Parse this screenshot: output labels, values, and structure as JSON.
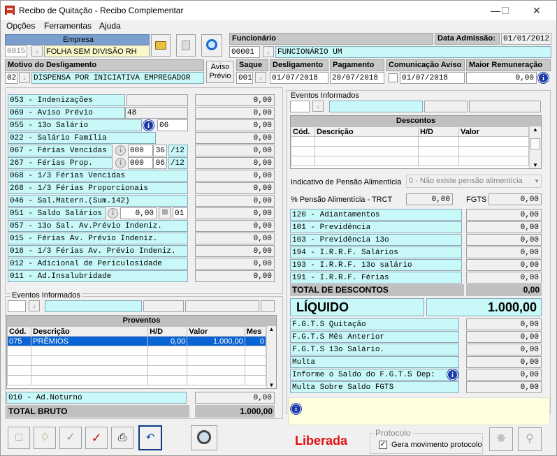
{
  "title": "Recibo de Quitação - Recibo Complementar",
  "menu": [
    "Opções",
    "Ferramentas",
    "Ajuda"
  ],
  "empresa": {
    "label": "Empresa",
    "code": "0015",
    "name": "FOLHA SEM DIVISÃO RH"
  },
  "funcionario": {
    "label": "Funcionário",
    "code": "00001",
    "name": "FUNCIONÁRIO UM"
  },
  "admissao": {
    "label": "Data Admissão:",
    "value": "01/01/2012"
  },
  "motivo": {
    "label": "Motivo do Desligamento",
    "code": "02",
    "name": "DISPENSA POR INICIATIVA EMPREGADOR"
  },
  "aviso_btn": "Aviso\nPrévio",
  "saque": {
    "label": "Saque",
    "value": "001"
  },
  "desligamento": {
    "label": "Desligamento",
    "value": "01/07/2018"
  },
  "pagamento": {
    "label": "Pagamento",
    "value": "20/07/2018"
  },
  "comunicacao": {
    "label": "Comunicação Aviso",
    "value": "01/07/2018"
  },
  "maior": {
    "label": "Maior Remuneração",
    "value": "0,00"
  },
  "left_rows": [
    {
      "label": "053 - Indenizações",
      "value": "0,00"
    },
    {
      "label": "069 - Aviso Prévio",
      "extra": "48",
      "value": "0,00"
    },
    {
      "label": "055 - 13o Salário",
      "extra": "06",
      "value": "0,00"
    },
    {
      "label": "022 - Salário Família",
      "value": "0,00"
    },
    {
      "label": "067 - Férias Vencidas",
      "a": "000",
      "b": "36",
      "c": "/12",
      "value": "0,00"
    },
    {
      "label": "267 - Férias Prop.",
      "a": "000",
      "b": "06",
      "c": "/12",
      "value": "0,00"
    },
    {
      "label": "068 - 1/3 Férias Vencidas",
      "value": "0,00"
    },
    {
      "label": "268 - 1/3 Férias Proporcionais",
      "value": "0,00"
    },
    {
      "label": "046 - Sal.Matern.(Sum.142)",
      "value": "0,00"
    },
    {
      "label": "051 - Saldo Salários",
      "a": "0,00",
      "b": "01",
      "value": "0,00"
    },
    {
      "label": "057 - 13o Sal. Av.Prévio Indeniz.",
      "value": "0,00"
    },
    {
      "label": "015 - Férias Av. Prévio Indeniz.",
      "value": "0,00"
    },
    {
      "label": "016 - 1/3 Férias Av. Prévio Indeniz.",
      "value": "0,00"
    },
    {
      "label": "012 - Adicional de Periculosidade",
      "value": "0,00"
    },
    {
      "label": "011 - Ad.Insalubridade",
      "value": "0,00"
    }
  ],
  "eventos_label": "Eventos Informados",
  "proventos": {
    "title": "Proventos",
    "cols": [
      "Cód.",
      "Descrição",
      "H/D",
      "Valor",
      "Mes"
    ],
    "rows": [
      [
        "075",
        "PRÊMIOS",
        "0,00",
        "1.000,00",
        "0"
      ]
    ]
  },
  "noturno": {
    "label": "010 - Ad.Noturno",
    "value": "0,00"
  },
  "total_bruto": {
    "label": "TOTAL BRUTO",
    "value": "1.000,00"
  },
  "descontos": {
    "title": "Descontos",
    "cols": [
      "Cód.",
      "Descrição",
      "H/D",
      "Valor"
    ]
  },
  "pensao": {
    "label": "Indicativo de Pensão Alimentícia",
    "value": "0 - Não existe pensão alimentícia"
  },
  "trct": {
    "label": "% Pensão Alimentícia - TRCT",
    "value": "0,00",
    "fgts_label": "FGTS",
    "fgts_value": "0,00"
  },
  "right_rows": [
    {
      "label": "120 - Adiantamentos",
      "value": "0,00"
    },
    {
      "label": "101 - Previdência",
      "value": "0,00"
    },
    {
      "label": "103 - Previdência 13o",
      "value": "0,00"
    },
    {
      "label": "194 - I.R.R.F. Salários",
      "value": "0,00"
    },
    {
      "label": "193 - I.R.R.F. 13o salário",
      "value": "0,00"
    },
    {
      "label": "191 - I.R.R.F. Férias",
      "value": "0,00"
    }
  ],
  "total_descontos": {
    "label": "TOTAL DE DESCONTOS",
    "value": "0,00"
  },
  "liquido": {
    "label": "LÍQUIDO",
    "value": "1.000,00"
  },
  "fgts_rows": [
    {
      "label": "F.G.T.S  Quitação",
      "value": "0,00"
    },
    {
      "label": "F.G.T.S  Mês Anterior",
      "value": "0,00"
    },
    {
      "label": "F.G.T.S  13o Salário.",
      "value": "0,00"
    },
    {
      "label": "Multa",
      "value": "0,00"
    },
    {
      "label": "Informe o Saldo do F.G.T.S Dep:",
      "value": "0,00"
    },
    {
      "label": "Multa Sobre Saldo FGTS",
      "value": "0,00"
    }
  ],
  "status": "Liberada",
  "protocolo": {
    "title": "Protocolo",
    "check": "Gera movimento protocolo"
  }
}
